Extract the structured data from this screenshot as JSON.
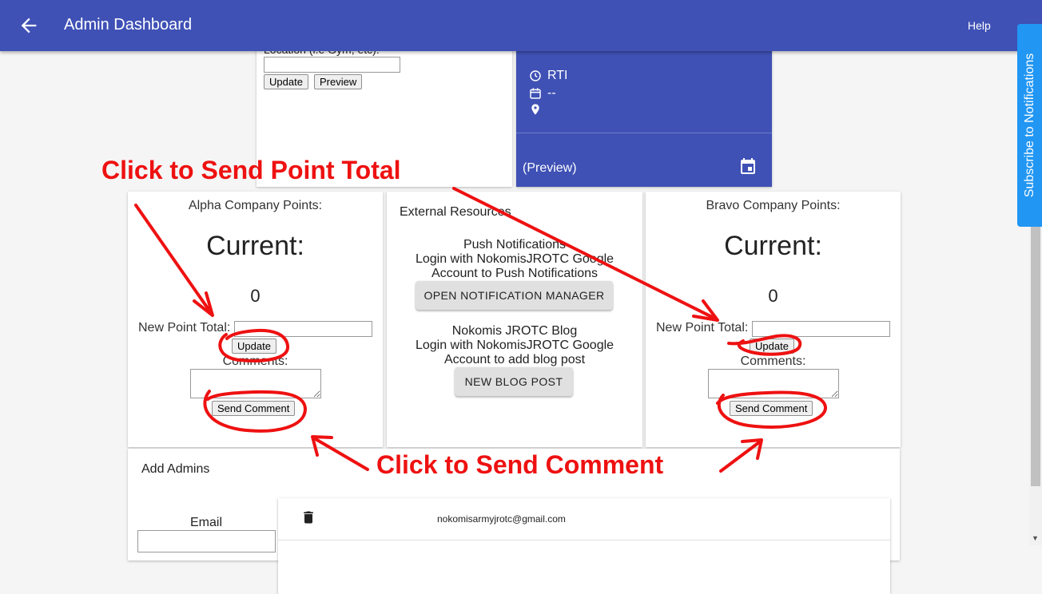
{
  "appbar": {
    "title": "Admin Dashboard",
    "help": "Help"
  },
  "subscribe": {
    "label": "Subscribe to Notifications"
  },
  "event_form": {
    "location_label": "Location (i.e Gym, etc):",
    "location_value": "",
    "update_label": "Update",
    "preview_label": "Preview"
  },
  "preview_card": {
    "time": "RTI",
    "date": "--",
    "location": "",
    "footer": "(Preview)"
  },
  "alpha": {
    "header": "Alpha Company Points:",
    "current_label": "Current:",
    "current_value": "0",
    "new_total_label": "New Point Total:",
    "update_label": "Update",
    "comments_label": "Comments:",
    "send_comment_label": "Send Comment"
  },
  "external": {
    "header": "External Resources",
    "push_title": "Push Notifications",
    "push_line1": "Login with NokomisJROTC Google",
    "push_line2": "Account to Push Notifications",
    "push_button": "OPEN NOTIFICATION MANAGER",
    "blog_title": "Nokomis JROTC Blog",
    "blog_line1": "Login with NokomisJROTC Google",
    "blog_line2": "Account to add blog post",
    "blog_button": "NEW BLOG POST"
  },
  "bravo": {
    "header": "Bravo Company Points:",
    "current_label": "Current:",
    "current_value": "0",
    "new_total_label": "New Point Total:",
    "update_label": "Update",
    "comments_label": "Comments:",
    "send_comment_label": "Send Comment"
  },
  "admins": {
    "header": "Add Admins",
    "email_label": "Email",
    "list": [
      {
        "email": "nokomisarmyjrotc@gmail.com"
      }
    ]
  },
  "annotations": {
    "send_point_total": "Click to Send Point Total",
    "send_comment": "Click to Send Comment",
    "color": "#ee1111"
  },
  "colors": {
    "primary": "#3f51b5",
    "subscribe": "#2196f3"
  }
}
